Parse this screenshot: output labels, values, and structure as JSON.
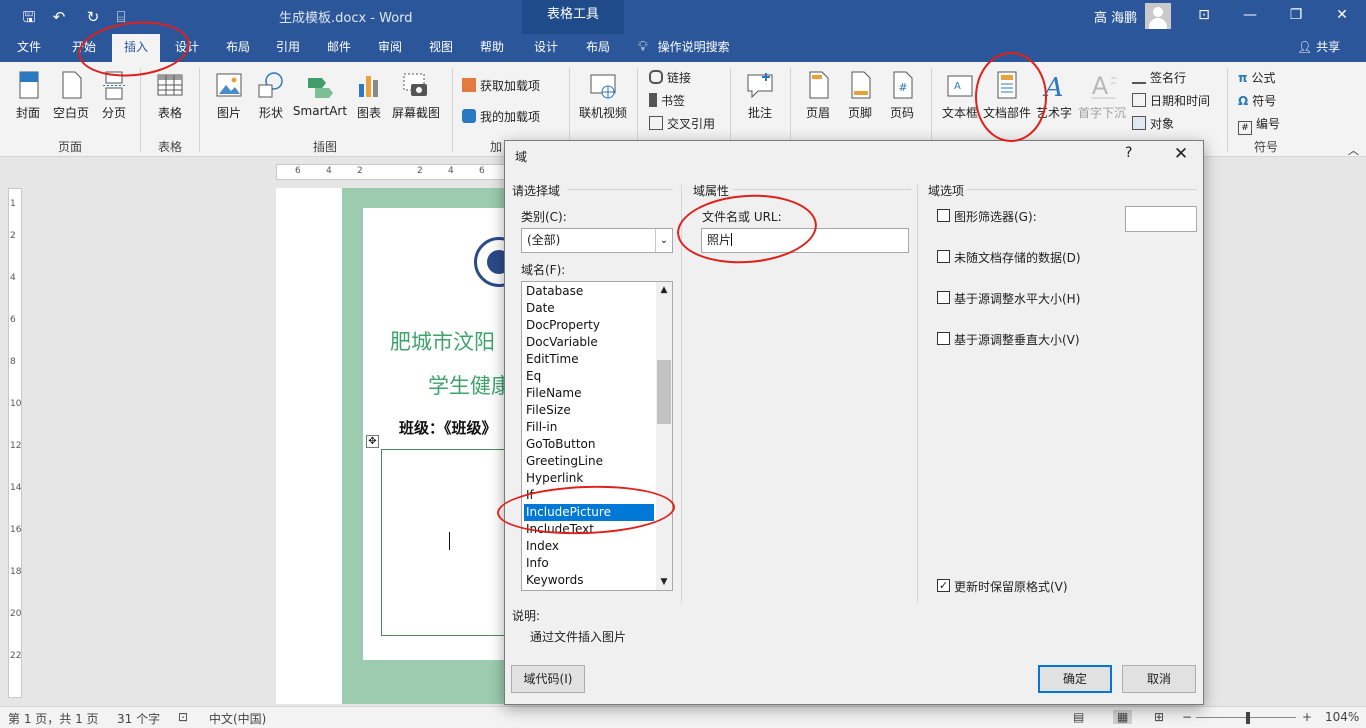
{
  "titlebar": {
    "doc_title": "生成模板.docx  -  Word",
    "context_tab_header": "表格工具",
    "user_name": "高 海鹏",
    "qat": {
      "save": "🖫",
      "undo": "↶",
      "redo": "↻",
      "customize": "⌸"
    },
    "controls": {
      "ribbon_display": "⊡",
      "minimize": "—",
      "restore": "❐",
      "close": "✕"
    }
  },
  "tabs": [
    {
      "label": "文件"
    },
    {
      "label": "开始"
    },
    {
      "label": "插入"
    },
    {
      "label": "设计"
    },
    {
      "label": "布局"
    },
    {
      "label": "引用"
    },
    {
      "label": "邮件"
    },
    {
      "label": "审阅"
    },
    {
      "label": "视图"
    },
    {
      "label": "帮助"
    },
    {
      "label": "设计"
    },
    {
      "label": "布局"
    }
  ],
  "tell_me": "操作说明搜索",
  "share": "共享",
  "ribbon": {
    "cover": "封面",
    "blank_page": "空白页",
    "page_break": "分页",
    "group_pages": "页面",
    "table": "表格",
    "group_tables": "表格",
    "picture": "图片",
    "shapes": "形状",
    "smartart": "SmartArt",
    "chart": "图表",
    "screenshot": "屏幕截图",
    "group_illustrations": "插图",
    "get_addins": "获取加载项",
    "my_addins": "我的加载项",
    "group_addins": "加",
    "online_video": "联机视频",
    "link": "链接",
    "bookmark": "书签",
    "cross_ref": "交叉引用",
    "comment": "批注",
    "header": "页眉",
    "footer": "页脚",
    "page_number": "页码",
    "textbox": "文本框",
    "quick_parts": "文档部件",
    "wordart": "艺术字",
    "dropcap": "首字下沉",
    "signature_line": "签名行",
    "date_time": "日期和时间",
    "object": "对象",
    "equation": "公式",
    "symbol": "符号",
    "number": "编号",
    "group_symbols": "符号"
  },
  "document": {
    "title_line1": "肥城市汶阳",
    "title_line2": "学生健康",
    "class_line": "班级：《班级》"
  },
  "ruler_top": [
    "6",
    "4",
    "2",
    "2",
    "4",
    "6"
  ],
  "ruler_left": [
    "1",
    "2",
    "4",
    "6",
    "8",
    "10",
    "12",
    "14",
    "16",
    "18",
    "20",
    "22"
  ],
  "statusbar": {
    "page": "第 1 页，共 1 页",
    "words": "31 个字",
    "language": "中文(中国)",
    "zoom": "104%"
  },
  "dialog": {
    "title": "域",
    "help": "?",
    "close": "✕",
    "choose_field": "请选择域",
    "category_label": "类别(C):",
    "category_value": "(全部)",
    "field_names_label": "域名(F):",
    "field_names": [
      "Database",
      "Date",
      "DocProperty",
      "DocVariable",
      "EditTime",
      "Eq",
      "FileName",
      "FileSize",
      "Fill-in",
      "GoToButton",
      "GreetingLine",
      "Hyperlink",
      "If",
      "IncludePicture",
      "IncludeText",
      "Index",
      "Info",
      "Keywords"
    ],
    "selected_field": "IncludePicture",
    "field_properties": "域属性",
    "filename_label": "文件名或 URL:",
    "filename_value": "照片",
    "field_options": "域选项",
    "opt_graphic_filter": "图形筛选器(G):",
    "opt_graphic_filter_value": "",
    "opt_not_stored": "未随文档存储的数据(D)",
    "opt_resize_h": "基于源调整水平大小(H)",
    "opt_resize_v": "基于源调整垂直大小(V)",
    "opt_preserve": "更新时保留原格式(V)",
    "opt_preserve_checked": true,
    "description_label": "说明:",
    "description": "通过文件插入图片",
    "field_codes_btn": "域代码(I)",
    "ok_btn": "确定",
    "cancel_btn": "取消"
  },
  "colors": {
    "accent": "#2b579a",
    "annotation": "#e0201b",
    "selection": "#0078d7"
  }
}
